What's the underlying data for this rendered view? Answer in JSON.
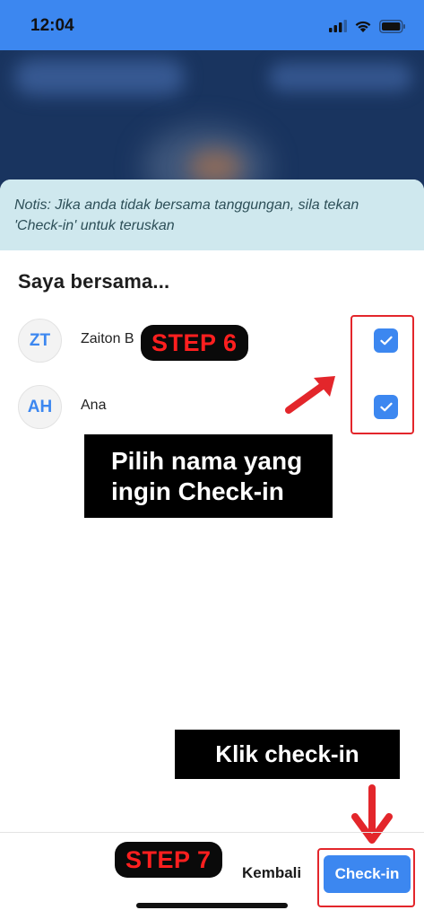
{
  "status_bar": {
    "time": "12:04",
    "icons": [
      "signal-icon",
      "wifi-icon",
      "battery-icon"
    ]
  },
  "notice": {
    "text": "Notis: Jika anda tidak bersama tanggungan, sila tekan 'Check-in' untuk teruskan"
  },
  "section_title": "Saya bersama...",
  "people": [
    {
      "initials": "ZT",
      "name": "Zaiton B",
      "checked": true
    },
    {
      "initials": "AH",
      "name": "Ana",
      "checked": true
    }
  ],
  "annotations": {
    "step6": "STEP 6",
    "step6_note_line1": "Pilih nama yang",
    "step6_note_line2": "ingin Check-in",
    "step7": "STEP 7",
    "step7_note": "Klik check-in"
  },
  "footer": {
    "back_label": "Kembali",
    "checkin_label": "Check-in"
  },
  "colors": {
    "primary": "#3c87f0",
    "header_bg": "#19345f",
    "notice_bg": "#cfe8ee",
    "annotation_red": "#e3262b"
  }
}
